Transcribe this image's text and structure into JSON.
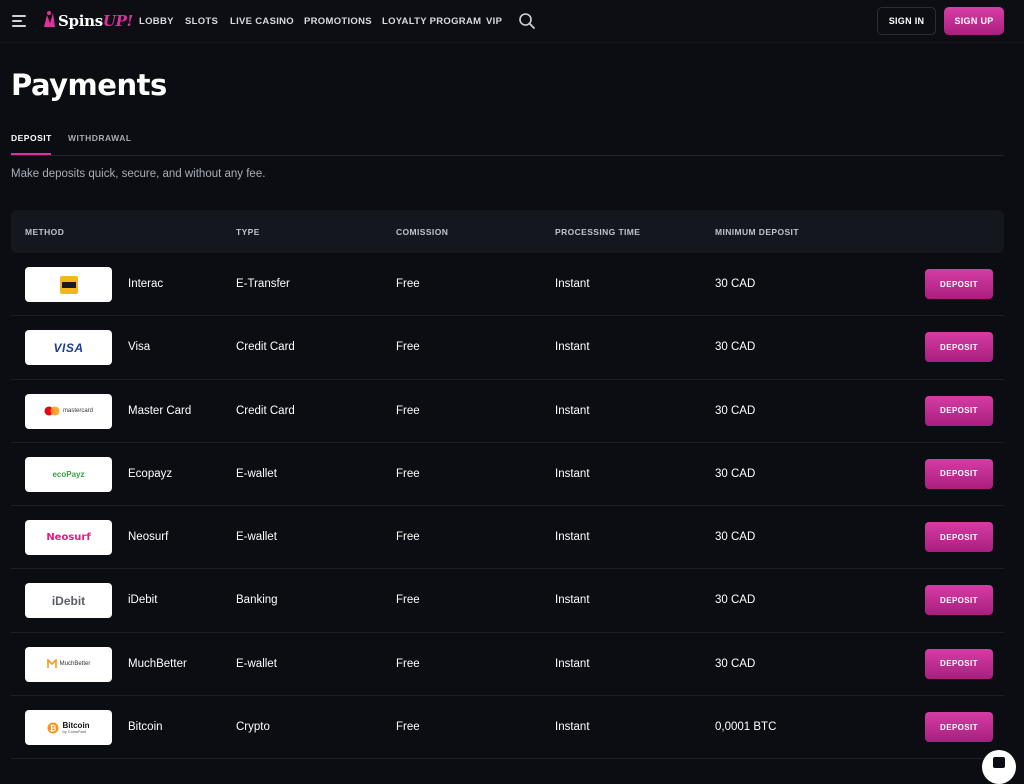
{
  "header": {
    "logo_text": "Spins",
    "logo_accent": "UP!",
    "nav": [
      "LOBBY",
      "SLOTS",
      "LIVE CASINO",
      "PROMOTIONS",
      "LOYALTY PROGRAM",
      "VIP"
    ],
    "signin_label": "SIGN IN",
    "signup_label": "SIGN UP"
  },
  "page": {
    "title": "Payments",
    "tabs": [
      "DEPOSIT",
      "WITHDRAWAL"
    ],
    "active_tab": "DEPOSIT",
    "subtitle": "Make deposits quick, secure, and without any fee."
  },
  "table": {
    "headers": [
      "METHOD",
      "TYPE",
      "COMISSION",
      "PROCESSING TIME",
      "MINIMUM DEPOSIT"
    ],
    "action_label": "DEPOSIT",
    "rows": [
      {
        "name": "Interac",
        "type": "E-Transfer",
        "fee": "Free",
        "time": "Instant",
        "min": "30 CAD",
        "logo_text": "Interac"
      },
      {
        "name": "Visa",
        "type": "Credit Card",
        "fee": "Free",
        "time": "Instant",
        "min": "30 CAD",
        "logo_text": "VISA"
      },
      {
        "name": "Master Card",
        "type": "Credit Card",
        "fee": "Free",
        "time": "Instant",
        "min": "30 CAD",
        "logo_text": "mastercard"
      },
      {
        "name": "Ecopayz",
        "type": "E-wallet",
        "fee": "Free",
        "time": "Instant",
        "min": "30 CAD",
        "logo_text": "ecoPayz"
      },
      {
        "name": "Neosurf",
        "type": "E-wallet",
        "fee": "Free",
        "time": "Instant",
        "min": "30 CAD",
        "logo_text": "Neosurf"
      },
      {
        "name": "iDebit",
        "type": "Banking",
        "fee": "Free",
        "time": "Instant",
        "min": "30 CAD",
        "logo_text": "iDebit"
      },
      {
        "name": "MuchBetter",
        "type": "E-wallet",
        "fee": "Free",
        "time": "Instant",
        "min": "30 CAD",
        "logo_text": "MuchBetter"
      },
      {
        "name": "Bitcoin",
        "type": "Crypto",
        "fee": "Free",
        "time": "Instant",
        "min": "0,0001 BTC",
        "logo_text": "Bitcoin",
        "logo_subtext": "by CoinsPaid"
      }
    ]
  },
  "colors": {
    "background": "#0b0d12",
    "accent": "#d9329f",
    "header_row": "#14171e"
  },
  "icons": [
    "menu-icon",
    "logo-icon",
    "search-icon",
    "chat-icon"
  ]
}
